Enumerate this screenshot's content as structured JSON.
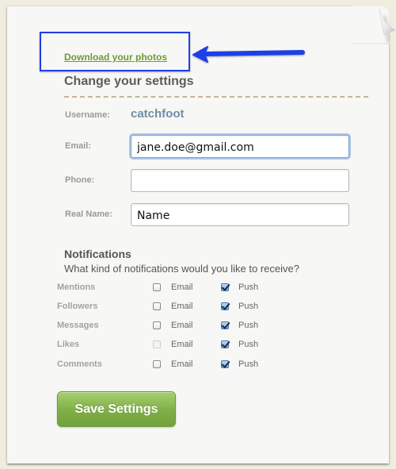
{
  "header": {
    "download_link": "Download your photos",
    "title": "Change your settings"
  },
  "annotation": {
    "highlight_color": "#1f3fe6",
    "arrow_points_to": "download_link"
  },
  "form": {
    "username": {
      "label": "Username:",
      "value": "catchfoot"
    },
    "email": {
      "label": "Email:",
      "value": "jane.doe@gmail.com",
      "focused": true
    },
    "phone": {
      "label": "Phone:",
      "value": ""
    },
    "real_name": {
      "label": "Real Name:",
      "value": "Name"
    }
  },
  "notifications": {
    "title": "Notifications",
    "subtitle": "What kind of notifications would you like to receive?",
    "email_label": "Email",
    "push_label": "Push",
    "rows": [
      {
        "label": "Mentions",
        "email": false,
        "email_disabled": false,
        "push": true
      },
      {
        "label": "Followers",
        "email": false,
        "email_disabled": false,
        "push": true
      },
      {
        "label": "Messages",
        "email": false,
        "email_disabled": false,
        "push": true
      },
      {
        "label": "Likes",
        "email": false,
        "email_disabled": true,
        "push": true
      },
      {
        "label": "Comments",
        "email": false,
        "email_disabled": false,
        "push": true
      }
    ]
  },
  "actions": {
    "save_label": "Save Settings"
  },
  "colors": {
    "link": "#6f9a35",
    "username": "#6f8ea6",
    "save_button": "#7eae46",
    "divider": "#c3b595"
  }
}
